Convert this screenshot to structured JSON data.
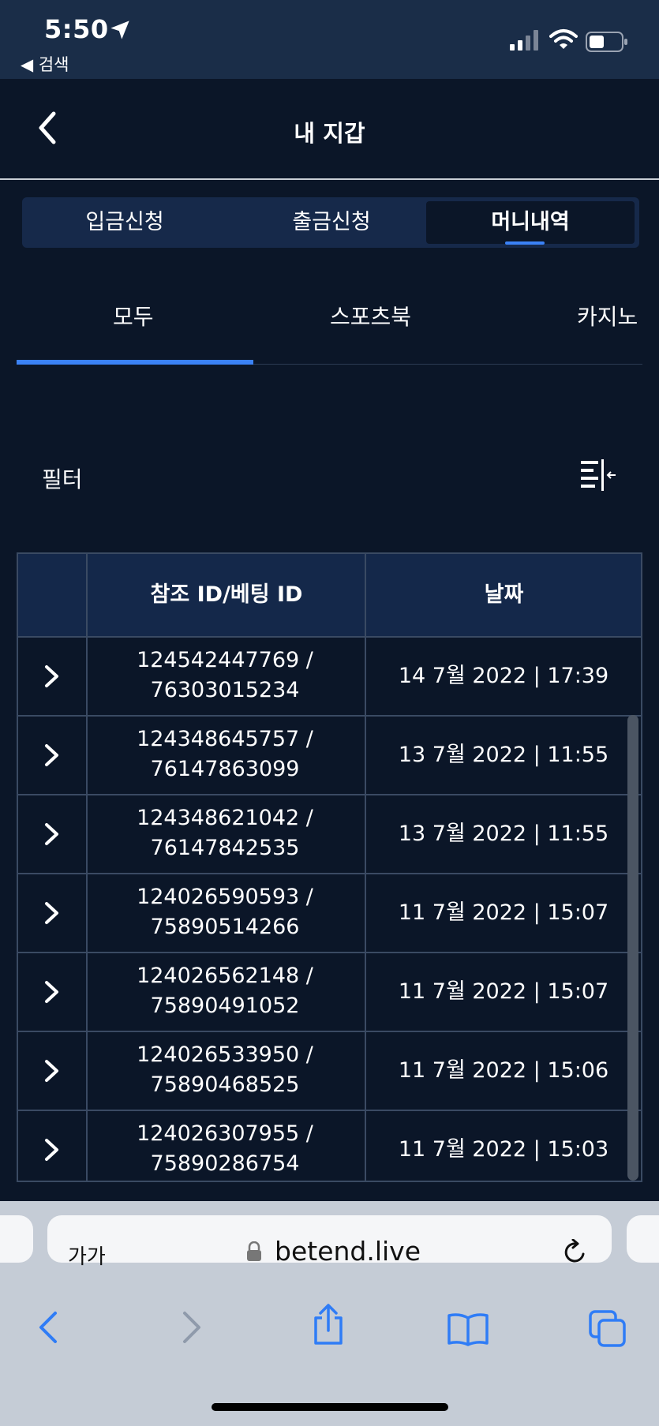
{
  "status_bar": {
    "time": "5:50",
    "back_label": "◀ 검색"
  },
  "header": {
    "title": "내 지갑"
  },
  "top_tabs": [
    {
      "label": "입금신청",
      "active": false
    },
    {
      "label": "출금신청",
      "active": false
    },
    {
      "label": "머니내역",
      "active": true
    }
  ],
  "sub_tabs": [
    {
      "label": "모두",
      "active": true
    },
    {
      "label": "스포츠북",
      "active": false
    },
    {
      "label": "카지노",
      "active": false
    }
  ],
  "filter": {
    "label": "필터"
  },
  "table": {
    "headers": [
      "",
      "참조 ID/베팅 ID",
      "날짜"
    ],
    "rows": [
      {
        "ref_line1": "124542447769 /",
        "ref_line2": "76303015234",
        "date": "14 7월 2022 | 17:39"
      },
      {
        "ref_line1": "124348645757 /",
        "ref_line2": "76147863099",
        "date": "13 7월 2022 | 11:55"
      },
      {
        "ref_line1": "124348621042 /",
        "ref_line2": "76147842535",
        "date": "13 7월 2022 | 11:55"
      },
      {
        "ref_line1": "124026590593 /",
        "ref_line2": "75890514266",
        "date": "11 7월 2022 | 15:07"
      },
      {
        "ref_line1": "124026562148 /",
        "ref_line2": "75890491052",
        "date": "11 7월 2022 | 15:07"
      },
      {
        "ref_line1": "124026533950 /",
        "ref_line2": "75890468525",
        "date": "11 7월 2022 | 15:06"
      },
      {
        "ref_line1": "124026307955 /",
        "ref_line2": "75890286754",
        "date": "11 7월 2022 | 15:03"
      }
    ]
  },
  "browser": {
    "font_size_label": "가가",
    "url": "betend.live"
  },
  "colors": {
    "background": "#0b1628",
    "header_bg": "#14284a",
    "accent": "#3b82f6",
    "browser_bg": "#c5ccd6"
  },
  "icons": [
    "location-arrow-icon",
    "signal-icon",
    "wifi-icon",
    "battery-icon",
    "back-chevron-icon",
    "filter-icon",
    "row-chevron-icon",
    "lock-icon",
    "reload-icon",
    "browser-back-icon",
    "browser-forward-icon",
    "share-icon",
    "bookmarks-icon",
    "tabs-icon"
  ]
}
